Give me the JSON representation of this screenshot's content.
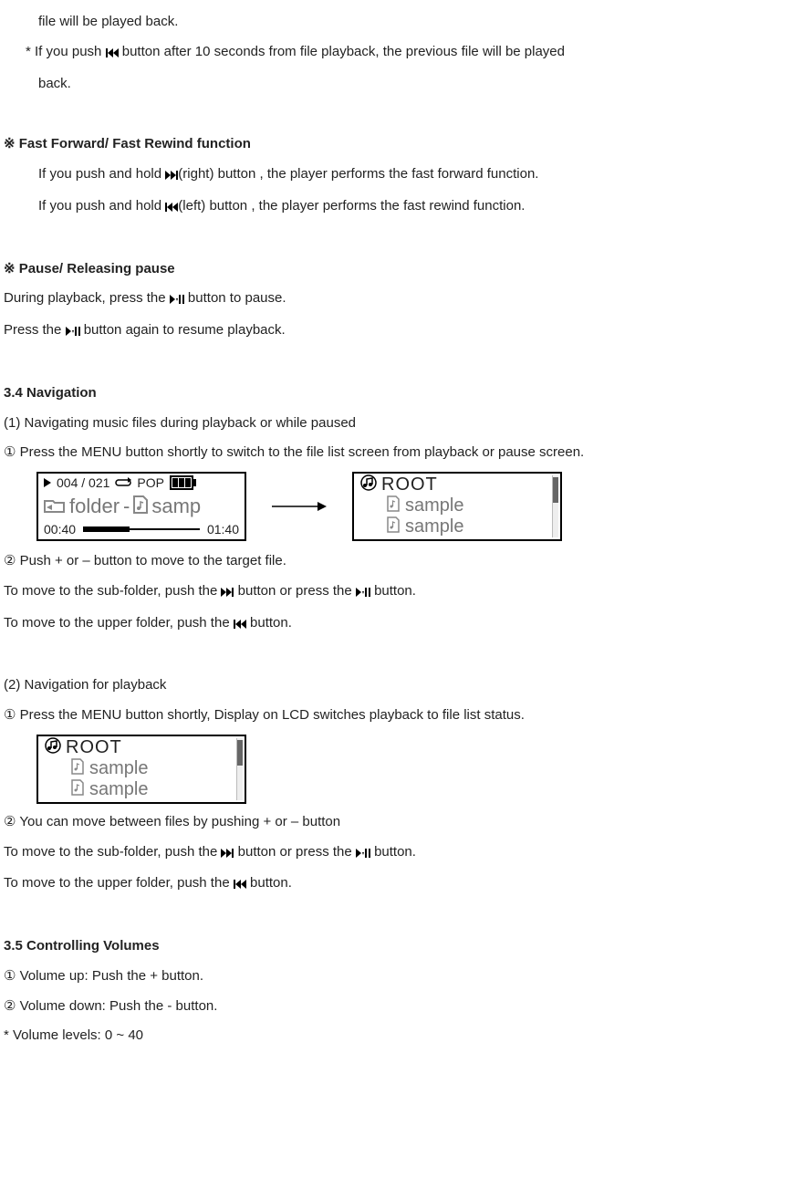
{
  "intro": {
    "line0": "file will be played back.",
    "line1_a": "* If you push ",
    "line1_b": " button after 10 seconds from file playback, the previous file will be played",
    "line2": "back."
  },
  "fastfwd": {
    "heading": "※ Fast Forward/ Fast Rewind function",
    "line1_a": "If you push and hold   ",
    "line1_b": "(right) button , the player performs the fast forward function.",
    "line2_a": "If you push and hold   ",
    "line2_b": "(left) button , the player performs the fast rewind function."
  },
  "pause": {
    "heading": "※ Pause/ Releasing pause",
    "line1_a": "During playback, press the ",
    "line1_b": " button to pause.",
    "line2_a": "Press the ",
    "line2_b": " button again to resume playback."
  },
  "nav": {
    "heading": "3.4 Navigation",
    "sub1": "(1) Navigating music files during playback or while paused",
    "step1": "① Press the MENU button shortly to switch to the file list screen from playback or pause screen.",
    "step2": "② Push + or – button to move to the target file.",
    "subline_a": "To move to the sub-folder, push the ",
    "subline_b": "  button or press the ",
    "subline_c": " button.",
    "upline_a": "To move to the upper folder, push the ",
    "upline_b": " button.",
    "sub2": "(2) Navigation for playback",
    "step1b": "① Press the MENU button shortly, Display on LCD switches playback to file list status.",
    "step2b": "② You can move between files by pushing + or – button"
  },
  "vol": {
    "heading": "3.5 Controlling Volumes",
    "l1": "① Volume up: Push the + button.",
    "l2": "② Volume down: Push the - button.",
    "l3": "* Volume levels: 0 ~ 40"
  },
  "lcd_playback": {
    "counter": "004 / 021",
    "eq": "POP",
    "folder_label": "folder",
    "track": "samp",
    "elapsed": "00:40",
    "total": "01:40",
    "progress_pct": 40
  },
  "filelist": {
    "root": "ROOT",
    "items": [
      "sample",
      "sample"
    ]
  }
}
